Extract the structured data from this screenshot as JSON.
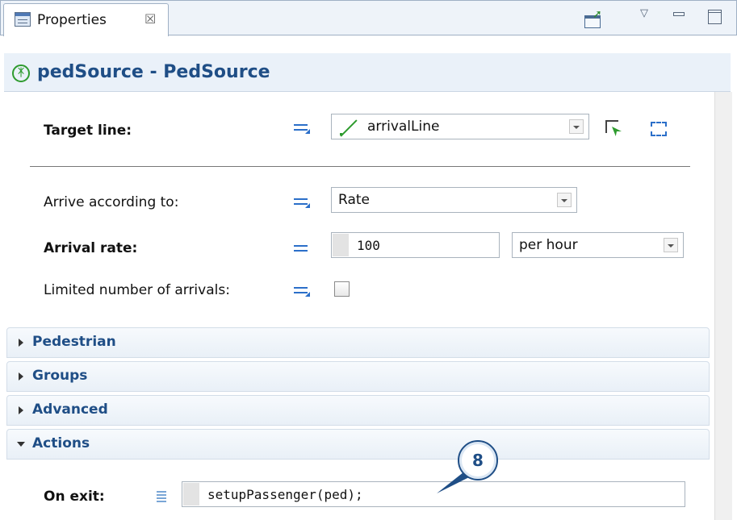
{
  "tab": {
    "title": "Properties",
    "close": "☒"
  },
  "header": {
    "title": "pedSource - PedSource"
  },
  "target_line": {
    "label": "Target line:",
    "value": "arrivalLine"
  },
  "arrive_according": {
    "label": "Arrive according to:",
    "value": "Rate"
  },
  "arrival_rate": {
    "label": "Arrival rate:",
    "value": "100",
    "unit": "per hour"
  },
  "limited_arrivals": {
    "label": "Limited number of arrivals:",
    "checked": false
  },
  "sections": [
    {
      "title": "Pedestrian",
      "expanded": false
    },
    {
      "title": "Groups",
      "expanded": false
    },
    {
      "title": "Advanced",
      "expanded": false
    },
    {
      "title": "Actions",
      "expanded": true
    }
  ],
  "on_exit": {
    "label": "On exit:",
    "value": "setupPassenger(ped);"
  },
  "callout": {
    "number": "8"
  },
  "colors": {
    "accent": "#1f4e86",
    "green": "#2e9b2e",
    "blue": "#2b6fc9"
  }
}
